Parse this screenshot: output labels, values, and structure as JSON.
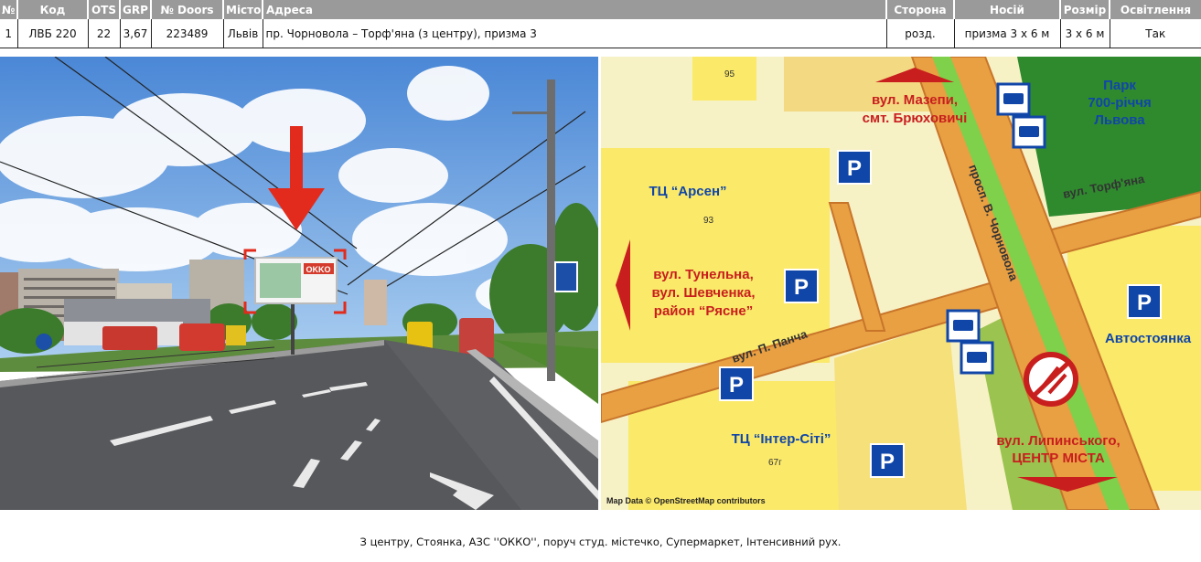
{
  "table": {
    "headers": [
      "№",
      "Код",
      "OTS",
      "GRP",
      "№ Doors",
      "Місто",
      "Адреса",
      "Сторона",
      "Носій",
      "Розмір",
      "Освітлення"
    ],
    "row": [
      "1",
      "ЛВБ 220",
      "22",
      "3,67",
      "223489",
      "Львів",
      "пр. Чорновола – Торф'яна (з центру), призма 3",
      "розд.",
      "призма 3 х 6 м",
      "3 х 6 м",
      "Так"
    ]
  },
  "photo": {
    "billboard_brand": "OKKO"
  },
  "map": {
    "labels": {
      "mazepy_1": "вул. Мазепи,",
      "mazepy_2": "смт. Брюховичі",
      "park_1": "Парк",
      "park_2": "700-річчя",
      "park_3": "Львова",
      "arsen": "ТЦ “Арсен”",
      "arsen_num": "93",
      "num_95": "95",
      "torfyana": "вул. Торф'яна",
      "chornovola": "просп. В. Чорновола",
      "tunelna_1": "вул. Тунельна,",
      "tunelna_2": "вул. Шевченка,",
      "tunelna_3": "район “Рясне”",
      "pancha": "вул. П. Панча",
      "avtostoyanka": "Автостоянка",
      "inter_city": "ТЦ “Інтер-Сіті”",
      "inter_num": "67г",
      "lypynskoho_1": "вул. Липинського,",
      "lypynskoho_2": "ЦЕНТР МІСТА",
      "credit": "Map Data © OpenStreetMap contributors",
      "parking": "P"
    },
    "colors": {
      "road": "#e8a042",
      "road_edge": "#c8752a",
      "block": "#fbe96a",
      "park": "#2f8a2e",
      "green_strip": "#7fd04a",
      "blue": "#1046a8",
      "red": "#c81e1e"
    }
  },
  "footer": {
    "text": "З центру, Стоянка, АЗС ''ОККО'', поруч студ. містечко, Супермаркет, Інтенсивний рух."
  }
}
